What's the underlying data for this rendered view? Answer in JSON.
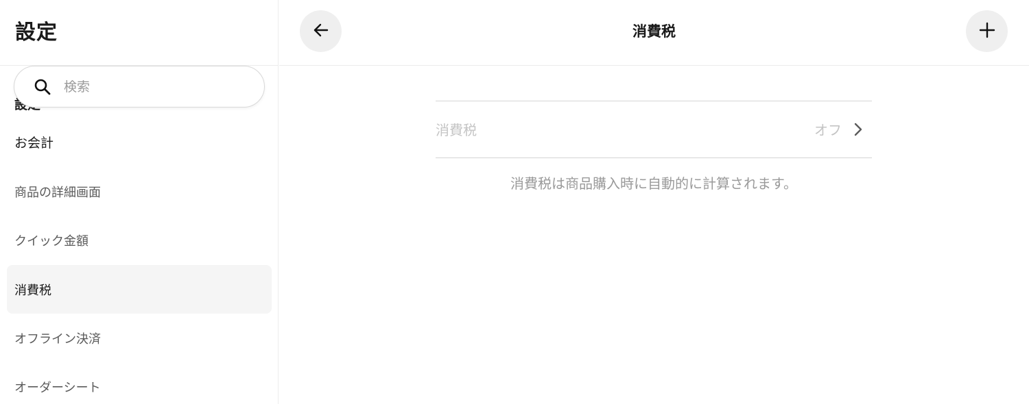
{
  "sidebar": {
    "title": "設定",
    "ghost_label": "設定",
    "search": {
      "placeholder": "検索",
      "value": ""
    },
    "items": [
      {
        "label": "お会計"
      },
      {
        "label": "商品の詳細画面"
      },
      {
        "label": "クイック金額"
      },
      {
        "label": "消費税"
      },
      {
        "label": "オフライン決済"
      },
      {
        "label": "オーダーシート"
      }
    ]
  },
  "main": {
    "title": "消費税",
    "tax_row": {
      "label": "消費税",
      "value": "オフ"
    },
    "note": "消費税は商品購入時に自動的に計算されます。"
  },
  "icons": {
    "back": "arrow-left-icon",
    "add": "plus-icon",
    "search": "search-icon",
    "chevron": "chevron-right-icon"
  },
  "colors": {
    "active_item_bg": "#f5f5f5",
    "circle_button_bg": "#efefef",
    "disabled_text": "#c4c4c4",
    "note_text": "#9a9a9a"
  }
}
